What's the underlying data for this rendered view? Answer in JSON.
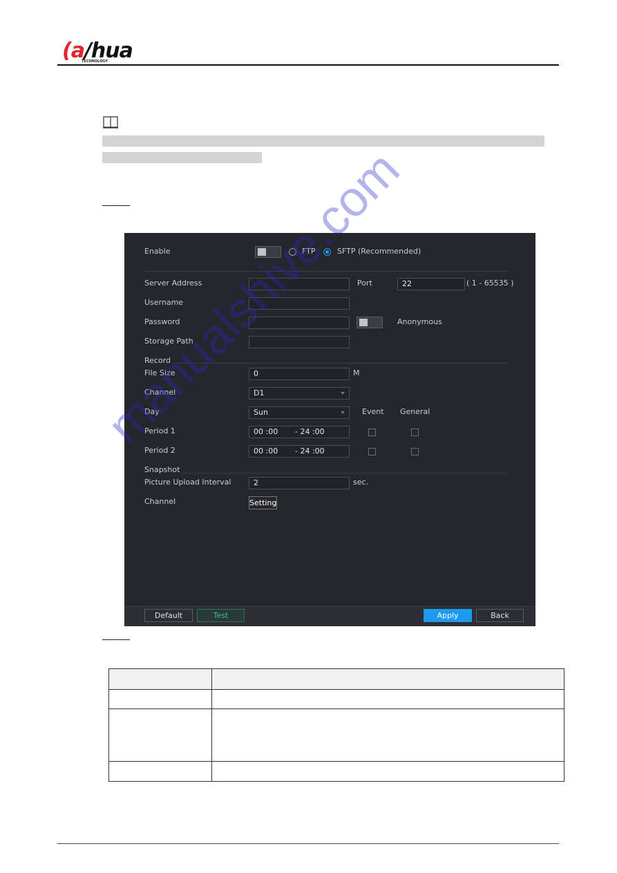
{
  "header": {
    "logo_text": "alhua",
    "logo_sub": "TECHNOLOGY"
  },
  "note": {
    "icon": "book-icon"
  },
  "ui": {
    "enable_label": "Enable",
    "ftp_label": "FTP",
    "sftp_label": "SFTP (Recommended)",
    "sftp_selected": true,
    "enable_on": false,
    "server_address_label": "Server Address",
    "server_address_value": "",
    "port_label": "Port",
    "port_value": "22",
    "port_range": "( 1 - 65535 )",
    "username_label": "Username",
    "username_value": "",
    "password_label": "Password",
    "password_value": "",
    "anonymous_label": "Anonymous",
    "anonymous_on": false,
    "storage_path_label": "Storage Path",
    "storage_path_value": "",
    "record_section": "Record",
    "file_size_label": "File Size",
    "file_size_value": "0",
    "file_size_unit": "M",
    "channel_label": "Channel",
    "channel_value": "D1",
    "day_label": "Day",
    "day_value": "Sun",
    "event_label": "Event",
    "general_label": "General",
    "period1_label": "Period 1",
    "period1_start": "00 :00",
    "period1_end": "- 24 :00",
    "period2_label": "Period 2",
    "period2_start": "00 :00",
    "period2_end": "- 24 :00",
    "snapshot_section": "Snapshot",
    "interval_label": "Picture Upload Interval",
    "interval_value": "2",
    "interval_unit": "sec.",
    "snap_channel_label": "Channel",
    "setting_button": "Setting",
    "default_button": "Default",
    "test_button": "Test",
    "apply_button": "Apply",
    "back_button": "Back",
    "colors": {
      "panel": "#25272c",
      "accent": "#1c9bf0",
      "test": "#3fbf8f"
    }
  },
  "watermark": "manualshive.com"
}
